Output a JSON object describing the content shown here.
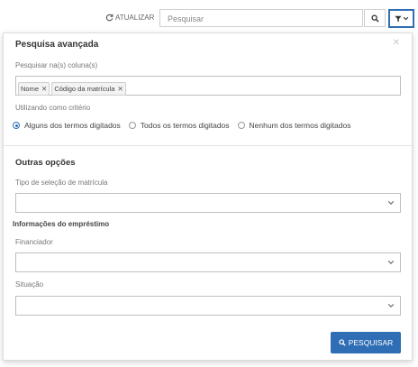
{
  "toolbar": {
    "refresh_label": "ATUALIZAR",
    "search_placeholder": "Pesquisar",
    "search_value": ""
  },
  "panel": {
    "title": "Pesquisa avançada",
    "columns_label": "Pesquisar na(s) coluna(s)",
    "tags": [
      {
        "label": "Nome"
      },
      {
        "label": "Código da matrícula"
      }
    ],
    "criteria_label": "Utilizando como critério",
    "radios": [
      {
        "label": "Alguns dos termos digitados",
        "selected": true
      },
      {
        "label": "Todos os termos digitados",
        "selected": false
      },
      {
        "label": "Nenhum dos termos digitados",
        "selected": false
      }
    ],
    "other_options_title": "Outras opções",
    "enrollment_type_label": "Tipo de seleção de matrícula",
    "enrollment_type_value": "",
    "loan_info_title": "Informações do empréstimo",
    "financier_label": "Financiador",
    "financier_value": "",
    "status_label": "Situação",
    "status_value": "",
    "search_button_label": "PESQUISAR"
  },
  "colors": {
    "accent": "#2f6eb5",
    "border": "#bfbfbf"
  },
  "icons": [
    "refresh-icon",
    "search-icon",
    "filter-icon",
    "chevron-down-icon",
    "close-icon"
  ]
}
